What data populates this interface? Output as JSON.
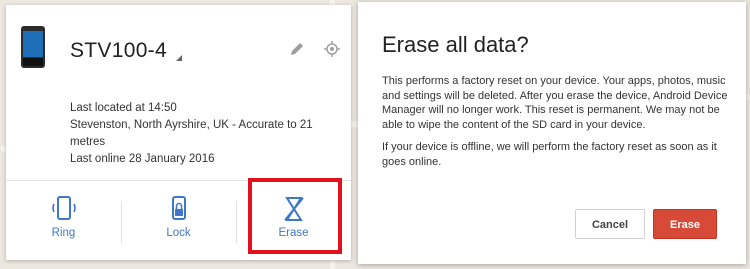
{
  "device": {
    "name": "STV100-4",
    "last_located": "Last located at 14:50",
    "location": "Stevenston, North Ayrshire, UK - Accurate to 21 metres",
    "last_online": "Last online 28 January 2016"
  },
  "actions": [
    {
      "label": "Ring",
      "icon": "phone-ring-icon"
    },
    {
      "label": "Lock",
      "icon": "lock-icon"
    },
    {
      "label": "Erase",
      "icon": "erase-icon"
    }
  ],
  "dialog": {
    "title": "Erase all data?",
    "paragraph1": "This performs a factory reset on your device. Your apps, photos, music and settings will be deleted. After you erase the device, Android Device Manager will no longer work. This reset is permanent. We may not be able to wipe the content of the SD card in your device.",
    "paragraph2": "If your device is offline, we will perform the factory reset as soon as it goes online.",
    "cancel_label": "Cancel",
    "erase_label": "Erase"
  },
  "colors": {
    "accent_blue": "#3e77c8",
    "highlight_red": "#e3101d",
    "erase_button": "#d84a38"
  }
}
